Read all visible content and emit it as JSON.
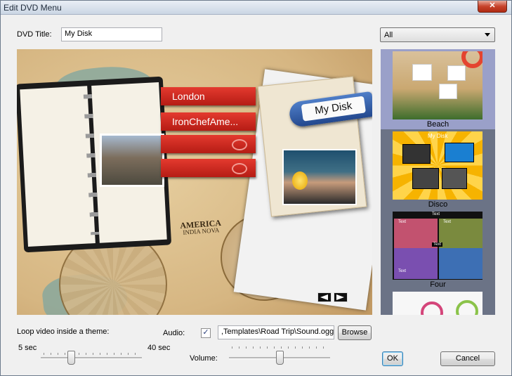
{
  "window": {
    "title": "Edit DVD Menu",
    "close_glyph": "✕"
  },
  "dvd_title": {
    "label": "DVD Title:",
    "value": "My Disk"
  },
  "theme_filter": {
    "selected": "All"
  },
  "preview": {
    "disk_label": "My Disk",
    "ribbons": [
      "London",
      "IronChefAme...",
      "",
      ""
    ],
    "map_caption_title": "AMERICA",
    "map_caption_text": "INDIA NOVA",
    "prev_icon": "arrow-left-icon",
    "next_icon": "arrow-right-icon"
  },
  "themes": [
    {
      "name": "Beach",
      "selected": true
    },
    {
      "name": "Disco",
      "selected": false
    },
    {
      "name": "Four",
      "selected": false
    },
    {
      "name": "",
      "selected": false
    }
  ],
  "disco_caption": "My Disk",
  "four_captions": [
    "Text",
    "Text",
    "Text",
    "Text",
    "Text"
  ],
  "loop": {
    "label": "Loop video inside a theme:",
    "min_label": "5 sec",
    "max_label": "40 sec",
    "value_fraction": 0.3
  },
  "audio": {
    "label": "Audio:",
    "checked": true,
    "check_glyph": "✓",
    "path": ",Templates\\Road Trip\\Sound.ogg",
    "browse_label": "Browse"
  },
  "volume": {
    "label": "Volume:",
    "value_fraction": 0.5
  },
  "buttons": {
    "ok": "OK",
    "cancel": "Cancel"
  },
  "colors": {
    "selection": "#9aa0c9",
    "list_bg": "#6b7386",
    "ribbon_red": "#d42b22",
    "tag_blue": "#2f5ea8"
  }
}
